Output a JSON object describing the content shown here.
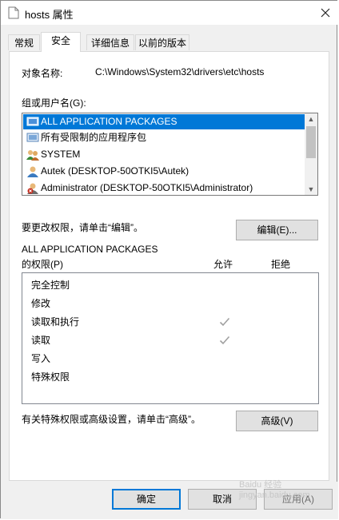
{
  "window": {
    "title": "hosts 属性"
  },
  "tabs": [
    {
      "label": "常规",
      "active": false
    },
    {
      "label": "安全",
      "active": true
    },
    {
      "label": "详细信息",
      "active": false
    },
    {
      "label": "以前的版本",
      "active": false
    }
  ],
  "object": {
    "label": "对象名称:",
    "value": "C:\\Windows\\System32\\drivers\\etc\\hosts"
  },
  "groups": {
    "label": "组或用户名(G):",
    "items": [
      {
        "label": "ALL APPLICATION PACKAGES",
        "icon": "app-packages-icon",
        "selected": true
      },
      {
        "label": "所有受限制的应用程序包",
        "icon": "app-packages-icon",
        "selected": false
      },
      {
        "label": "SYSTEM",
        "icon": "users-group-icon",
        "selected": false
      },
      {
        "label": "Autek (DESKTOP-50OTKI5\\Autek)",
        "icon": "user-icon",
        "selected": false
      },
      {
        "label": "Administrator (DESKTOP-50OTKI5\\Administrator)",
        "icon": "admin-user-icon",
        "selected": false
      }
    ]
  },
  "change_hint": "要更改权限，请单击“编辑”。",
  "edit_button": "编辑(E)...",
  "permissions": {
    "title_line1": "ALL APPLICATION PACKAGES",
    "title_line2": "的权限(P)",
    "allow_header": "允许",
    "deny_header": "拒绝",
    "rows": [
      {
        "label": "完全控制",
        "allow": false,
        "deny": false
      },
      {
        "label": "修改",
        "allow": false,
        "deny": false
      },
      {
        "label": "读取和执行",
        "allow": true,
        "deny": false
      },
      {
        "label": "读取",
        "allow": true,
        "deny": false
      },
      {
        "label": "写入",
        "allow": false,
        "deny": false
      },
      {
        "label": "特殊权限",
        "allow": false,
        "deny": false
      }
    ]
  },
  "advanced_hint": "有关特殊权限或高级设置，请单击“高级”。",
  "advanced_button": "高级(V)",
  "footer": {
    "ok": "确定",
    "cancel": "取消",
    "apply": "应用(A)"
  },
  "watermark": "Baidu 经验 jingyan.baidu.com",
  "colors": {
    "selection": "#0078d7",
    "dialog_bg": "#f0f0f0",
    "check": "#a0a0a0"
  }
}
